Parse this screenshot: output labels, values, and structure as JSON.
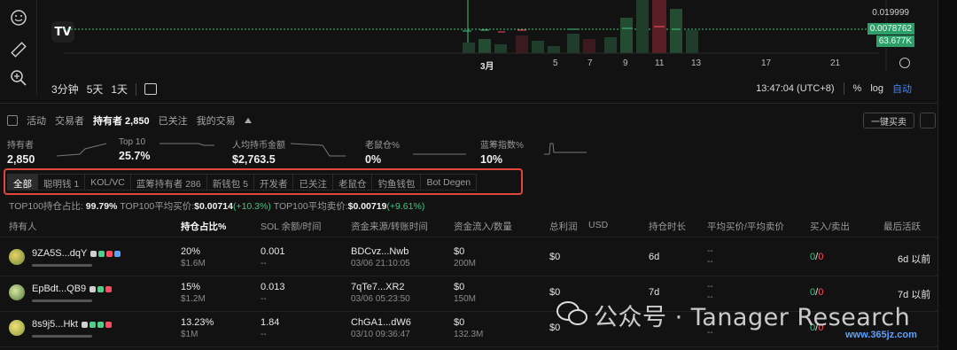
{
  "chart": {
    "price_top": "0.019999",
    "price_current": "0.0078762",
    "volume": "63.677K",
    "x_ticks": [
      "3月",
      "5",
      "7",
      "9",
      "11",
      "13",
      "17",
      "21"
    ],
    "timeframes": [
      "3分钟",
      "5天",
      "1天"
    ],
    "clock": "13:47:04 (UTC+8)",
    "pct": "%",
    "log": "log",
    "auto": "自动"
  },
  "tabs": {
    "activity": "活动",
    "traders": "交易者",
    "holders": "持有者 2,850",
    "followed": "已关注",
    "my_trades": "我的交易",
    "one_click_buy": "一键买卖"
  },
  "stats": [
    {
      "label": "持有者",
      "value": "2,850"
    },
    {
      "label": "Top 10",
      "value": "25.7%"
    },
    {
      "label": "人均持币金额",
      "value": "$2,763.5"
    },
    {
      "label": "老鼠仓%",
      "value": "0%"
    },
    {
      "label": "蓝筹指数%",
      "value": "10%"
    }
  ],
  "filters": [
    "全部",
    "聪明钱 1",
    "KOL/VC",
    "蓝筹持有者 286",
    "新钱包 5",
    "开发者",
    "已关注",
    "老鼠仓",
    "钓鱼钱包",
    "Bot Degen"
  ],
  "top100": {
    "hold_label": "TOP100持仓占比:",
    "hold_value": "99.79%",
    "avg_buy_label": "TOP100平均买价:",
    "avg_buy_value": "$0.00714",
    "avg_buy_change": "(+10.3%)",
    "avg_sell_label": "TOP100平均卖价:",
    "avg_sell_value": "$0.00719",
    "avg_sell_change": "(+9.61%)"
  },
  "columns": {
    "holder": "持有人",
    "share": "持仓占比%",
    "sol": "SOL 余额/时间",
    "source": "资金来源/转账时间",
    "flow": "资金流入/数量",
    "pnl": "总利润",
    "usd": "USD",
    "duration": "持仓时长",
    "avg_price": "平均买价/平均卖价",
    "buy_sell": "买入/卖出",
    "last_active": "最后活跃"
  },
  "rows": [
    {
      "addr": "9ZA5S...dqY",
      "share": "20%",
      "share_usd": "$1.6M",
      "sol": "0.001",
      "sol_time": "--",
      "source": "BDCvz...Nwb",
      "source_time": "03/06 21:10:05",
      "flow": "$0",
      "qty": "200M",
      "pnl": "$0",
      "duration": "6d",
      "avg1": "--",
      "avg2": "--",
      "buy": "0",
      "sell": "0",
      "last": "6d 以前"
    },
    {
      "addr": "EpBdt...QB9",
      "share": "15%",
      "share_usd": "$1.2M",
      "sol": "0.013",
      "sol_time": "--",
      "source": "7qTe7...XR2",
      "source_time": "03/06 05:23:50",
      "flow": "$0",
      "qty": "150M",
      "pnl": "$0",
      "duration": "7d",
      "avg1": "--",
      "avg2": "--",
      "buy": "0",
      "sell": "0",
      "last": "7d 以前"
    },
    {
      "addr": "8s9j5...Hkt",
      "share": "13.23%",
      "share_usd": "$1M",
      "sol": "1.84",
      "sol_time": "--",
      "source": "ChGA1...dW6",
      "source_time": "03/10 09:36:47",
      "flow": "$0",
      "qty": "132.3M",
      "pnl": "$0",
      "duration": "",
      "avg1": "--",
      "avg2": "--",
      "buy": "0",
      "sell": "0",
      "last": ""
    }
  ],
  "watermark": "公众号 · Tanager Research",
  "watermark_site": "www.365jz.com"
}
